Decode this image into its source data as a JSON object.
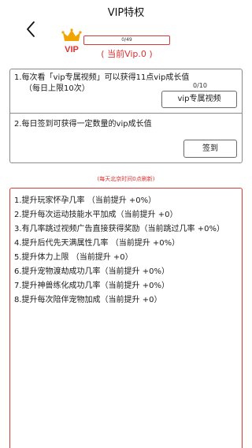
{
  "header": {
    "title": "VIP特权",
    "back_icon": "back-arrow-icon"
  },
  "vip": {
    "badge_icon": "crown-icon",
    "badge_text": "VIP",
    "progress_text": "0/49",
    "progress_fraction": 0.0,
    "current_level": "( 当前Vip.0 )",
    "colors": {
      "crown": "#f0a500",
      "vip_text": "#e03030",
      "accent": "#d63a3a"
    }
  },
  "tasks": {
    "video": {
      "line1": "1.每次看「vip专属视频」可以获得11点vip成长值",
      "line2": "（每日上限10次）",
      "count": "0/10",
      "button": "vip专属视频"
    },
    "signin": {
      "line1": "2.每日签到可获得一定数量的vip成长值",
      "button": "签到"
    },
    "refresh_note": "(每天北京时间0点刷新)"
  },
  "bonuses": [
    "1.提升玩家怀孕几率 （当前提升 +0%）",
    "2.提升每次运动技能水平加成（当前提升 +0）",
    "3.有几率跳过视频广告直接获得奖励（当前跳过几率 +0%）",
    "4.提升后代先天满属性几率 （当前提升 +0%）",
    "5.提升体力上限 （当前提升 +0）",
    "6.提升宠物渡劫成功几率（当前提升 +0%）",
    "7.提升神兽练化成功几率（当前提升 +0%）",
    "8.提升每次陪伴宠物加成（当前提升 +0）"
  ]
}
